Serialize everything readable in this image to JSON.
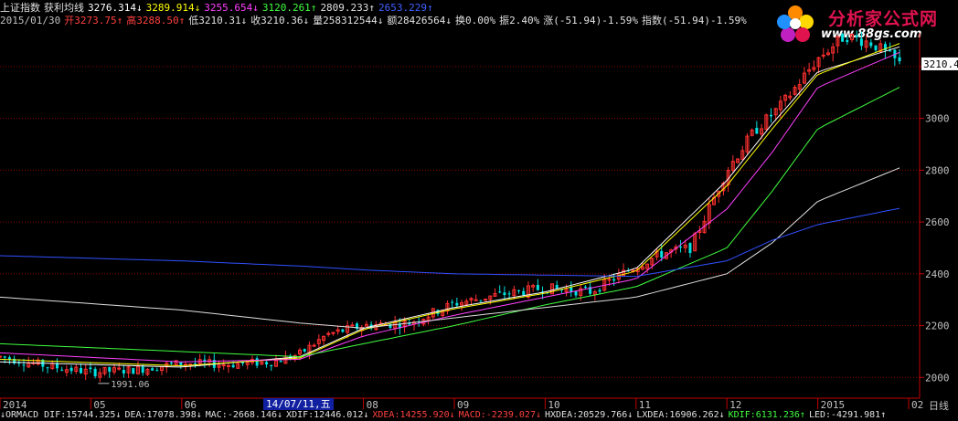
{
  "header": {
    "line1": [
      {
        "text": "上证指数",
        "color": "#e0e0e0"
      },
      {
        "text": "获利均线",
        "color": "#e0e0e0"
      },
      {
        "text": "3276.314↓",
        "color": "#ffffff"
      },
      {
        "text": "3289.914↓",
        "color": "#ffff00"
      },
      {
        "text": "3255.654↓",
        "color": "#ff40ff"
      },
      {
        "text": "3120.261↑",
        "color": "#40ff40"
      },
      {
        "text": "2809.233↑",
        "color": "#e0e0e0"
      },
      {
        "text": "2653.229↑",
        "color": "#4060ff"
      }
    ],
    "line2": [
      {
        "text": "2015/01/30",
        "color": "#c0c0c0"
      },
      {
        "text": "开3273.75↑",
        "color": "#ff4040"
      },
      {
        "text": "高3288.50↑",
        "color": "#ff4040"
      },
      {
        "text": "低3210.31↓",
        "color": "#e0e0e0"
      },
      {
        "text": "收3210.36↓",
        "color": "#e0e0e0"
      },
      {
        "text": "量258312544↓",
        "color": "#e0e0e0"
      },
      {
        "text": "额28426564↓",
        "color": "#e0e0e0"
      },
      {
        "text": "换0.00%",
        "color": "#e0e0e0"
      },
      {
        "text": "振2.40%",
        "color": "#e0e0e0"
      },
      {
        "text": "涨(-51.94)-1.59%",
        "color": "#e0e0e0"
      },
      {
        "text": "指数(-51.94)-1.59%",
        "color": "#e0e0e0"
      }
    ]
  },
  "footer": {
    "line": [
      {
        "text": "↓ORMACD DIF:15744.325↓",
        "color": "#e0e0e0"
      },
      {
        "text": "DEA:17078.398↓",
        "color": "#e0e0e0"
      },
      {
        "text": "MAC:-2668.146↓",
        "color": "#e0e0e0"
      },
      {
        "text": "XDIF:12446.012↓",
        "color": "#e0e0e0"
      },
      {
        "text": "XDEA:14255.920↓",
        "color": "#ff4040"
      },
      {
        "text": "MACD:-2239.027↓",
        "color": "#ff4040"
      },
      {
        "text": "HXDEA:20529.766↓",
        "color": "#e0e0e0"
      },
      {
        "text": "LXDEA:16906.262↓",
        "color": "#e0e0e0"
      },
      {
        "text": "KDIF:6131.236↑",
        "color": "#40ff40"
      },
      {
        "text": "LED:-4291.981↑",
        "color": "#e0e0e0"
      }
    ]
  },
  "logo": {
    "main": "分析家公式网",
    "url": "www.88gs.com"
  },
  "cursor_date": "14/07/11,五",
  "chart_data": {
    "type": "candlestick",
    "title": "上证指数",
    "period_label": "日线",
    "y_ticks": [
      2000,
      2200,
      2400,
      2600,
      2800,
      3000,
      3200
    ],
    "ylim": [
      1920,
      3330
    ],
    "last_price_label": "3210.4",
    "last_price": 3210.4,
    "min_annotation": {
      "label": "1991.06",
      "value": 1991.06,
      "month": "05"
    },
    "x_months": [
      "2014",
      "05",
      "06",
      "07",
      "08",
      "09",
      "10",
      "11",
      "12",
      "2015",
      "02"
    ],
    "x_month_index": [
      0,
      1,
      2,
      3,
      4,
      5,
      6,
      7,
      8,
      9,
      10
    ],
    "price_path_months": [
      0,
      0.5,
      1,
      1.5,
      2,
      2.5,
      3,
      3.3,
      3.6,
      4,
      4.5,
      5,
      5.5,
      6,
      6.5,
      7,
      7.3,
      7.6,
      8,
      8.3,
      8.6,
      9,
      9.3,
      9.6,
      9.9
    ],
    "price_path_values": [
      2080,
      2045,
      2020,
      2030,
      2055,
      2050,
      2060,
      2090,
      2165,
      2200,
      2210,
      2285,
      2320,
      2345,
      2330,
      2430,
      2480,
      2500,
      2800,
      2950,
      3050,
      3230,
      3320,
      3290,
      3210
    ],
    "series": [
      {
        "name": "3276.314",
        "color": "#ffffff",
        "months": [
          0,
          2,
          3.3,
          4,
          5,
          6,
          7,
          8,
          8.5,
          9,
          9.9
        ],
        "values": [
          2060,
          2040,
          2080,
          2190,
          2270,
          2330,
          2420,
          2760,
          2980,
          3180,
          3276
        ]
      },
      {
        "name": "3289.914",
        "color": "#ffff00",
        "months": [
          0,
          2,
          3.3,
          4,
          5,
          6,
          7,
          8,
          8.5,
          9,
          9.9
        ],
        "values": [
          2070,
          2045,
          2075,
          2185,
          2265,
          2325,
          2410,
          2740,
          2960,
          3170,
          3289
        ]
      },
      {
        "name": "3255.654",
        "color": "#ff40ff",
        "months": [
          0,
          2,
          3.3,
          4,
          5,
          6,
          7,
          8,
          8.5,
          9,
          9.9
        ],
        "values": [
          2095,
          2060,
          2070,
          2160,
          2240,
          2310,
          2380,
          2650,
          2870,
          3120,
          3255
        ]
      },
      {
        "name": "3120.261",
        "color": "#40ff40",
        "months": [
          0,
          2,
          3.3,
          4,
          5,
          6,
          7,
          8,
          8.5,
          9,
          9.9
        ],
        "values": [
          2130,
          2100,
          2080,
          2130,
          2200,
          2280,
          2350,
          2500,
          2720,
          2960,
          3120
        ]
      },
      {
        "name": "2809.233",
        "color": "#e0e0e0",
        "months": [
          0,
          2,
          3.3,
          4,
          5,
          6,
          7,
          8,
          8.5,
          9,
          9.9
        ],
        "values": [
          2310,
          2260,
          2210,
          2190,
          2230,
          2270,
          2310,
          2400,
          2520,
          2680,
          2809
        ]
      },
      {
        "name": "2653.229",
        "color": "#3050ff",
        "months": [
          0,
          2,
          3.3,
          4,
          5,
          6,
          7,
          8,
          8.5,
          9,
          9.9
        ],
        "values": [
          2470,
          2450,
          2430,
          2415,
          2400,
          2395,
          2390,
          2450,
          2530,
          2590,
          2653
        ]
      }
    ]
  }
}
